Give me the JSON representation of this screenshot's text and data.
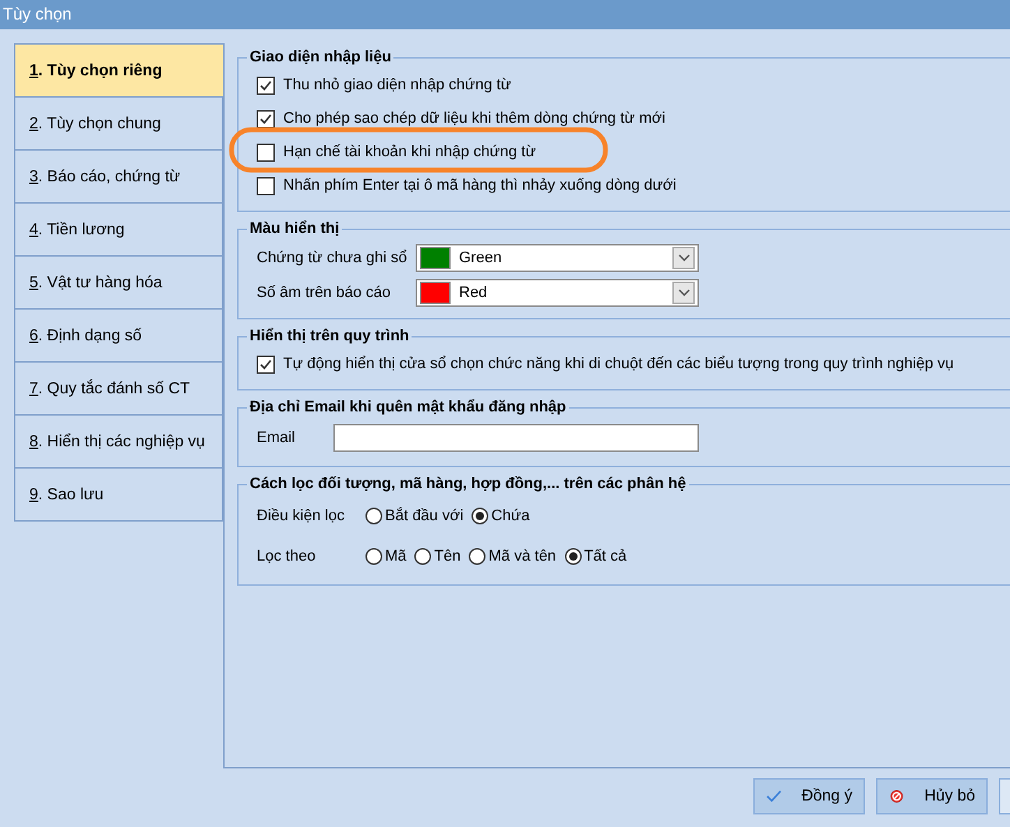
{
  "window": {
    "title": "Tùy chọn"
  },
  "sidebar": {
    "items": [
      {
        "label": "1. Tùy chọn riêng",
        "selected": true
      },
      {
        "label": "2. Tùy chọn chung",
        "selected": false
      },
      {
        "label": "3. Báo cáo, chứng từ",
        "selected": false
      },
      {
        "label": "4. Tiền lương",
        "selected": false
      },
      {
        "label": "5. Vật tư hàng hóa",
        "selected": false
      },
      {
        "label": "6. Định dạng số",
        "selected": false
      },
      {
        "label": "7. Quy tắc đánh số CT",
        "selected": false
      },
      {
        "label": "8. Hiển thị các nghiệp vụ",
        "selected": false
      },
      {
        "label": "9. Sao lưu",
        "selected": false
      }
    ]
  },
  "groups": [
    {
      "title": "Giao diện nhập liệu",
      "rows": [
        {
          "kind": "checkbox",
          "label": "Thu nhỏ giao diện nhập chứng từ",
          "checked": true,
          "circled": false
        },
        {
          "kind": "checkbox",
          "label": "Cho phép sao chép dữ liệu khi thêm dòng chứng từ mới",
          "checked": true,
          "circled": false
        },
        {
          "kind": "checkbox",
          "label": "Hạn chế tài khoản khi nhập chứng từ",
          "checked": false,
          "circled": true
        },
        {
          "kind": "checkbox",
          "label": "Nhấn phím Enter tại ô mã hàng thì nhảy xuống dòng dưới",
          "checked": false,
          "circled": false
        }
      ]
    },
    {
      "title": "Màu hiển thị",
      "rows": [
        {
          "kind": "color-select",
          "label": "Chứng từ chưa ghi sổ",
          "value": "Green",
          "color": "#008000"
        },
        {
          "kind": "color-select",
          "label": "Số âm trên báo cáo",
          "value": "Red",
          "color": "#ff0000"
        }
      ]
    },
    {
      "title": "Hiển thị trên quy trình",
      "rows": [
        {
          "kind": "checkbox",
          "label": "Tự động hiển thị cửa sổ chọn chức năng khi di chuột đến các biểu tượng trong quy trình nghiệp vụ",
          "checked": true,
          "circled": false
        }
      ]
    },
    {
      "title": "Địa chỉ Email khi quên mật khẩu đăng nhập",
      "rows": [
        {
          "kind": "text-field",
          "label": "Email"
        }
      ]
    },
    {
      "title": "Cách lọc đối tượng, mã hàng, hợp đồng,... trên các phân hệ",
      "rows": [
        {
          "kind": "radio-group",
          "label": "Điều kiện lọc",
          "options": [
            {
              "label": "Bắt đầu với",
              "selected": false
            },
            {
              "label": "Chứa",
              "selected": true
            }
          ]
        },
        {
          "kind": "radio-group",
          "label": "Lọc theo",
          "options": [
            {
              "label": "Mã",
              "selected": false
            },
            {
              "label": "Tên",
              "selected": false
            },
            {
              "label": "Mã và tên",
              "selected": false
            },
            {
              "label": "Tất cả",
              "selected": true
            }
          ]
        }
      ]
    }
  ],
  "buttons": [
    {
      "kind": "ok",
      "label": "Đồng ý"
    },
    {
      "kind": "cancel",
      "label": "Hủy bỏ"
    },
    {
      "kind": "blank"
    }
  ]
}
